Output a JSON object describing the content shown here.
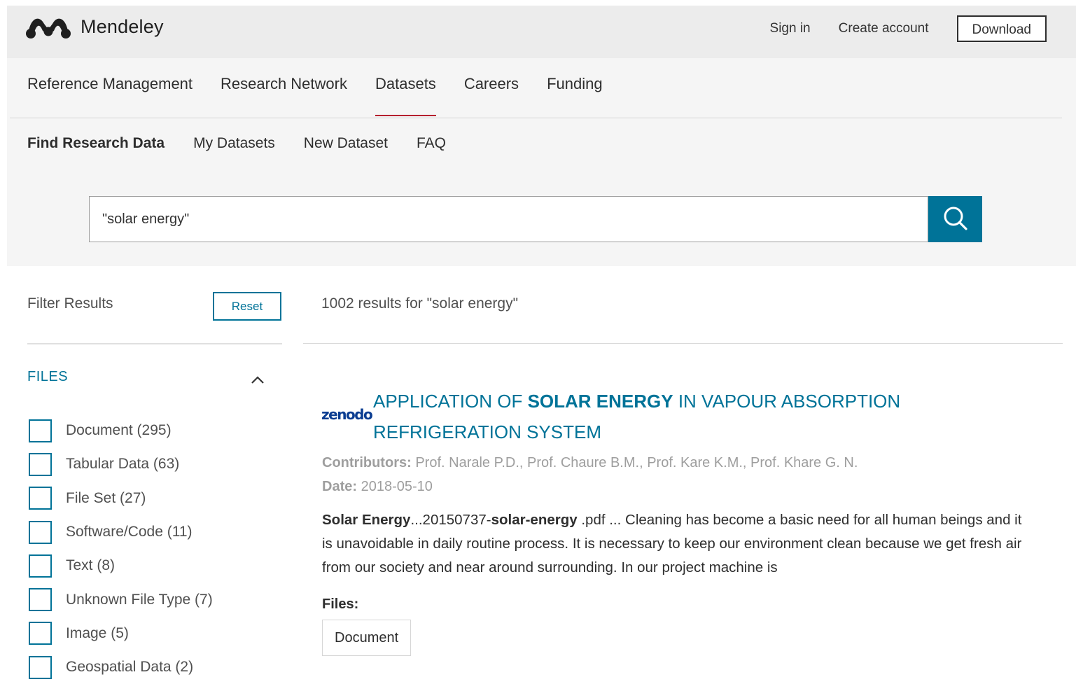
{
  "header": {
    "brand": "Mendeley",
    "sign_in": "Sign in",
    "create_account": "Create account",
    "download": "Download"
  },
  "main_nav": {
    "items": [
      {
        "label": "Reference Management"
      },
      {
        "label": "Research Network"
      },
      {
        "label": "Datasets",
        "active": true
      },
      {
        "label": "Careers"
      },
      {
        "label": "Funding"
      }
    ]
  },
  "sub_nav": {
    "items": [
      {
        "label": "Find Research Data",
        "active": true
      },
      {
        "label": "My Datasets"
      },
      {
        "label": "New Dataset"
      },
      {
        "label": "FAQ"
      }
    ]
  },
  "search": {
    "value": "\"solar energy\"",
    "button_icon": "search-icon"
  },
  "filters": {
    "title": "Filter Results",
    "reset": "Reset",
    "facet": {
      "title": "FILES",
      "toggle_icon": "chevron-up-icon",
      "options": [
        {
          "label": "Document (295)",
          "checked": false
        },
        {
          "label": "Tabular Data (63)",
          "checked": false
        },
        {
          "label": "File Set (27)",
          "checked": false
        },
        {
          "label": "Software/Code (11)",
          "checked": false
        },
        {
          "label": "Text (8)",
          "checked": false
        },
        {
          "label": "Unknown File Type (7)",
          "checked": false
        },
        {
          "label": "Image (5)",
          "checked": false
        },
        {
          "label": "Geospatial Data (2)",
          "checked": false
        }
      ]
    }
  },
  "results": {
    "count_text": "1002 results for \"solar energy\"",
    "items": [
      {
        "source": "zenodo",
        "title_before": "APPLICATION OF ",
        "title_highlight": "SOLAR ENERGY",
        "title_after": " IN VAPOUR ABSORPTION REFRIGERATION SYSTEM",
        "contributors_label": "Contributors:",
        "contributors": "Prof. Narale P.D., Prof. Chaure B.M., Prof. Kare K.M., Prof. Khare G. N.",
        "date_label": "Date:",
        "date": "2018-05-10",
        "snippet_b1": "Solar Energy",
        "snippet_t1": "...20150737-",
        "snippet_b2": "solar-energy",
        "snippet_t2": " .pdf ... Cleaning has become a basic need for all human beings and it is unavoidable in daily routine process. It is necessary to keep our environment clean because we get fresh air from our society and near around surrounding. In our project machine is",
        "files_label": "Files:",
        "files": [
          "Document"
        ]
      }
    ]
  },
  "colors": {
    "accent": "#007398",
    "active_underline": "#b5202e",
    "header_bg": "#ececec",
    "band_bg": "#f5f5f5"
  }
}
